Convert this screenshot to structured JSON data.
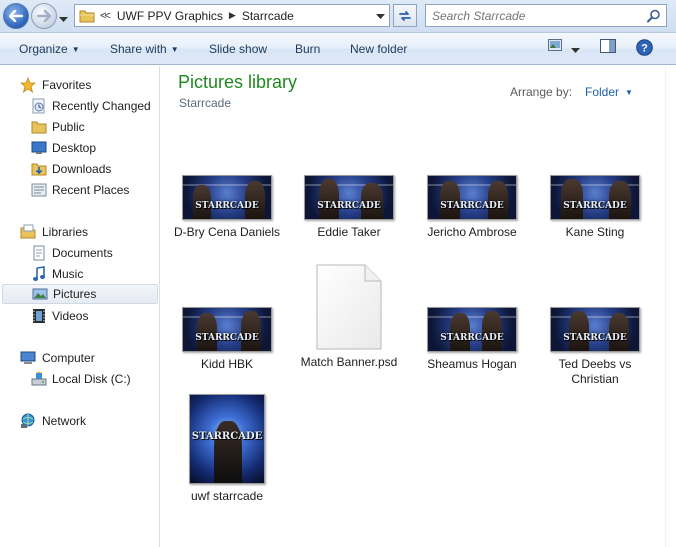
{
  "window": {
    "breadcrumb": [
      "UWF PPV Graphics",
      "Starrcade"
    ],
    "search_placeholder": "Search Starrcade"
  },
  "toolbar": {
    "organize": "Organize",
    "share_with": "Share with",
    "slide_show": "Slide show",
    "burn": "Burn",
    "new_folder": "New folder"
  },
  "nav": {
    "favorites": {
      "label": "Favorites",
      "items": [
        "Recently Changed",
        "Public",
        "Desktop",
        "Downloads",
        "Recent Places"
      ]
    },
    "libraries": {
      "label": "Libraries",
      "items": [
        "Documents",
        "Music",
        "Pictures",
        "Videos"
      ],
      "selected": "Pictures"
    },
    "computer": {
      "label": "Computer",
      "items": [
        "Local Disk (C:)"
      ]
    },
    "network": {
      "label": "Network"
    }
  },
  "content": {
    "title": "Pictures library",
    "subtitle": "Starrcade",
    "arrange_label": "Arrange by:",
    "arrange_value": "Folder",
    "files": [
      {
        "name": "D-Bry Cena Daniels",
        "type": "image"
      },
      {
        "name": "Eddie Taker",
        "type": "image"
      },
      {
        "name": "Jericho Ambrose",
        "type": "image"
      },
      {
        "name": "Kane Sting",
        "type": "image"
      },
      {
        "name": "Kidd HBK",
        "type": "image"
      },
      {
        "name": "Match Banner.psd",
        "type": "document"
      },
      {
        "name": "Sheamus Hogan",
        "type": "image"
      },
      {
        "name": "Ted Deebs vs Christian",
        "type": "image"
      },
      {
        "name": "uwf starrcade",
        "type": "image"
      }
    ],
    "thumbnail_logo_text": "STARRCADE"
  },
  "colors": {
    "library_title": "#1e8a1e",
    "command_text": "#1e395b",
    "link_blue": "#1e5fa8",
    "selection_bg": "#e5ebf2"
  }
}
